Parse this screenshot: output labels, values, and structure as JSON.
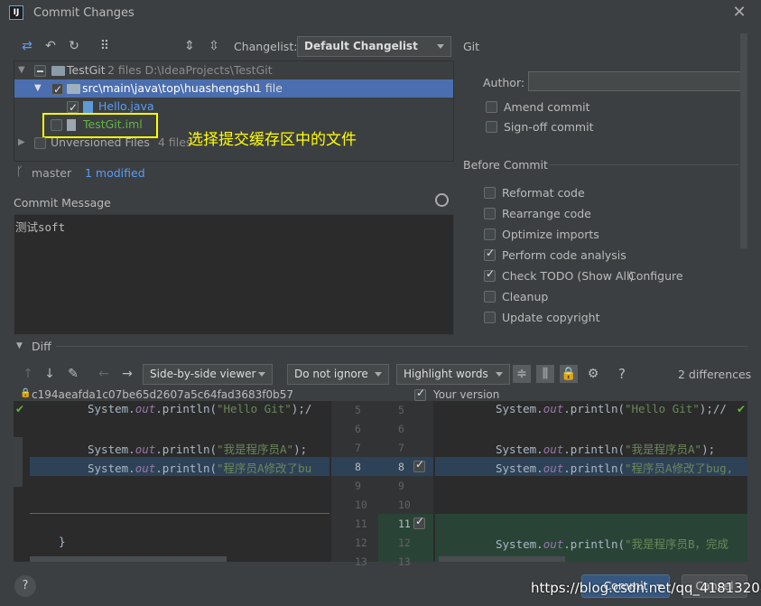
{
  "window": {
    "title": "Commit Changes",
    "app_icon": "IJ"
  },
  "toolbar": {
    "changelist_label": "Changelist:",
    "changelist_value": "Default Changelist"
  },
  "git_label": "Git",
  "tree": {
    "root": {
      "name": "TestGit",
      "meta": "2 files  D:\\IdeaProjects\\TestGit"
    },
    "folder": {
      "name": "src\\main\\java\\top\\huashengshu",
      "meta": "1 file"
    },
    "file1": "Hello.java",
    "file2": "TestGit.iml",
    "unversioned": {
      "name": "Unversioned Files",
      "meta": "4 files"
    }
  },
  "annotation": "选择提交缓存区中的文件",
  "branch": {
    "name": "master",
    "modified": "1 modified"
  },
  "commit_message": {
    "label": "Commit Message",
    "text": "测试soft"
  },
  "git_options": {
    "author_label": "Author:",
    "author_value": "",
    "amend": "Amend commit",
    "signoff": "Sign-off commit"
  },
  "before_commit": {
    "label": "Before Commit",
    "items": [
      {
        "label": "Reformat code",
        "checked": false
      },
      {
        "label": "Rearrange code",
        "checked": false
      },
      {
        "label": "Optimize imports",
        "checked": false
      },
      {
        "label": "Perform code analysis",
        "checked": true
      },
      {
        "label": "Check TODO (Show All)",
        "checked": true
      },
      {
        "label": "Cleanup",
        "checked": false
      },
      {
        "label": "Update copyright",
        "checked": false
      }
    ],
    "configure_link": "Configure"
  },
  "diff": {
    "label": "Diff",
    "viewer": "Side-by-side viewer",
    "ignore": "Do not ignore",
    "highlight": "Highlight words",
    "help": "?",
    "differences": "2 differences",
    "left_rev": "c194aeafda1c07be65d2607a5c64fad3683f0b57",
    "right_rev": "Your version",
    "left_lines": [
      {
        "pre": "System.",
        "out": "out",
        "mid": ".println(",
        "str": "\"Hello Git\"",
        "post": ");/"
      },
      {
        "pre": "",
        "out": "",
        "mid": "",
        "str": "",
        "post": ""
      },
      {
        "pre": "System.",
        "out": "out",
        "mid": ".println(",
        "str": "\"我是程序员A\"",
        "post": ");"
      },
      {
        "pre": "System.",
        "out": "out",
        "mid": ".println(",
        "str": "\"程序员A修改了bu",
        "post": ""
      }
    ],
    "right_lines": [
      {
        "pre": "System.",
        "out": "out",
        "mid": ".println(",
        "str": "\"Hello Git\"",
        "post": ");//"
      },
      {
        "pre": "",
        "out": "",
        "mid": "",
        "str": "",
        "post": ""
      },
      {
        "pre": "System.",
        "out": "out",
        "mid": ".println(",
        "str": "\"我是程序员A\"",
        "post": ");"
      },
      {
        "pre": "System.",
        "out": "out",
        "mid": ".println(",
        "str": "\"程序员A修改了bug,",
        "post": ""
      }
    ],
    "right_added": {
      "pre": "System.",
      "out": "out",
      "mid": ".println(",
      "str": "\"我是程序员B，完成",
      "post": ""
    },
    "closing_brace": "}",
    "left_nums": [
      "5",
      "6",
      "7",
      "8",
      "9",
      "10",
      "11",
      "12",
      "13"
    ],
    "right_nums": [
      "5",
      "6",
      "7",
      "8",
      "9",
      "10",
      "11",
      "12",
      "13"
    ]
  },
  "footer": {
    "help": "?",
    "commit": "Commit",
    "cancel": "Cancel",
    "watermark": "https://blog.csdn.net/qq_41813208"
  }
}
